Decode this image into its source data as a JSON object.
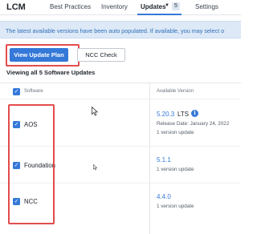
{
  "nav": {
    "brand": "LCM",
    "items": [
      {
        "label": "Best Practices"
      },
      {
        "label": "Inventory"
      },
      {
        "label": "Updates",
        "badge": "5",
        "active": true
      },
      {
        "label": "Settings"
      }
    ]
  },
  "banner": {
    "text": "The latest available versions have been auto populated. If available, you may select o"
  },
  "actions": {
    "primary_label": "View Update Plan",
    "secondary_label": "NCC Check"
  },
  "summary": "Viewing all 5 Software Updates",
  "table": {
    "headers": {
      "software": "Software",
      "available": "Available Version"
    },
    "rows": [
      {
        "name": "AOS",
        "version": "5.20.3",
        "tag": "LTS",
        "release": "Release Date: January 24, 2022",
        "updates": "1 version update",
        "checked": true
      },
      {
        "name": "Foundation",
        "version": "5.1.1",
        "updates": "1 version update",
        "checked": true
      },
      {
        "name": "NCC",
        "version": "4.4.0",
        "updates": "1 version update",
        "checked": true
      }
    ]
  },
  "colors": {
    "accent": "#3478d8",
    "highlight": "#e34c4c",
    "banner_bg": "#dde9f7"
  }
}
